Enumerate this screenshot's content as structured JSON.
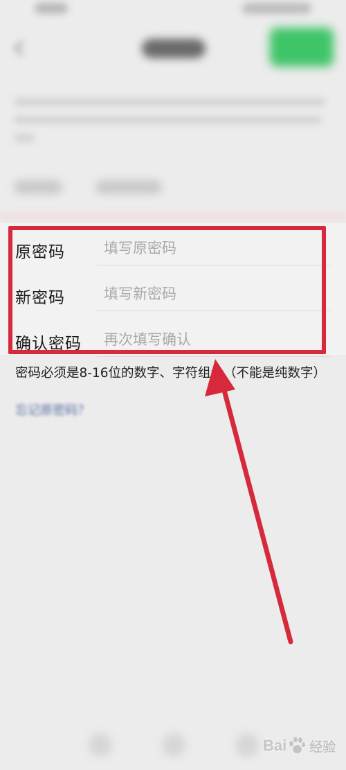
{
  "colors": {
    "background": "#ececec",
    "annotation_red": "#d62a3c",
    "text": "#1a1a1a",
    "placeholder": "#a9a9a9",
    "accent_green": "#3fc468",
    "link": "#5b6fa6"
  },
  "form": {
    "fields": [
      {
        "label": "原密码",
        "placeholder": "填写原密码"
      },
      {
        "label": "新密码",
        "placeholder": "填写新密码"
      },
      {
        "label": "确认密码",
        "placeholder": "再次填写确认"
      }
    ]
  },
  "hint": "密码必须是8-16位的数字、字符组合（不能是纯数字）",
  "forgot_link": "忘记原密码？",
  "watermark": {
    "brand": "Bai",
    "suffix": "经验"
  },
  "icons": {
    "back": "back-arrow-icon",
    "watermark_logo": "paw-icon"
  }
}
